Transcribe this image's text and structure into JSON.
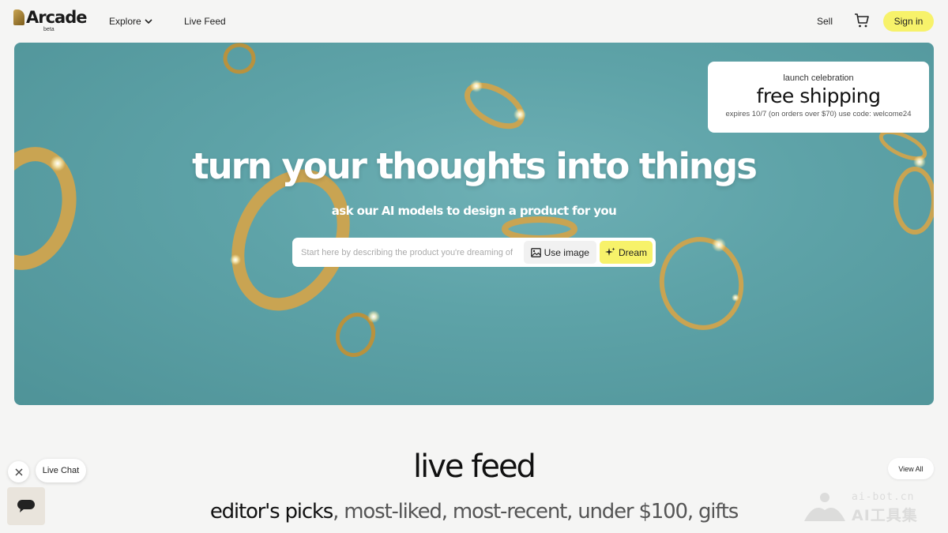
{
  "header": {
    "logo_text": "Arcade",
    "logo_badge": "beta",
    "nav": {
      "explore": "Explore",
      "live_feed": "Live Feed"
    },
    "sell": "Sell",
    "cart_icon": "cart-icon",
    "sign_in": "Sign in"
  },
  "hero": {
    "title": "turn your thoughts into things",
    "subtitle": "ask our AI models to design a product for you",
    "search": {
      "placeholder": "Start here by describing the product you're dreaming of",
      "use_image_label": "Use image",
      "dream_label": "Dream"
    },
    "promo": {
      "kicker": "launch celebration",
      "headline": "free shipping",
      "fine_print": "expires 10/7 (on orders over $70) use code: welcome24"
    }
  },
  "live_feed": {
    "title": "live feed",
    "view_all": "View All",
    "categories": [
      {
        "label": "editor's picks",
        "active": true
      },
      {
        "label": "most-liked",
        "active": false
      },
      {
        "label": "most-recent",
        "active": false
      },
      {
        "label": "under $100",
        "active": false
      },
      {
        "label": "gifts",
        "active": false
      }
    ],
    "separator": ", "
  },
  "chat": {
    "label": "Live Chat",
    "close_icon": "close-icon",
    "chat_icon": "chat-bubble-icon"
  },
  "watermark": {
    "url": "ai-bot.cn",
    "name": "AI工具集"
  },
  "colors": {
    "hero_bg": "#5ea3a8",
    "accent_yellow": "#f7f26a",
    "ring_gold": "#c9a452"
  }
}
